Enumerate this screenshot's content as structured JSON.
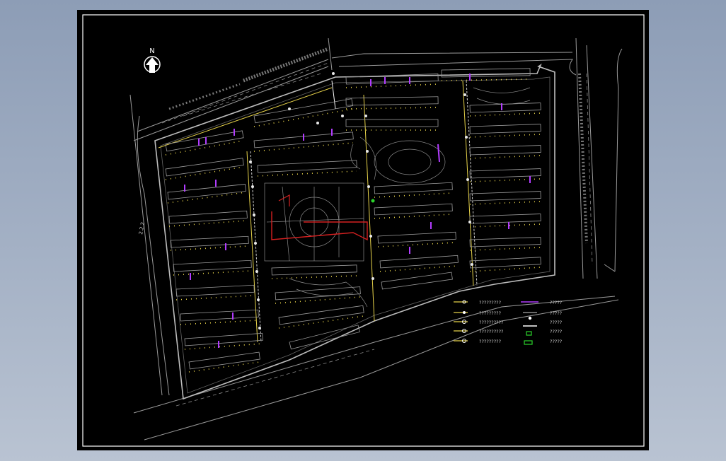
{
  "compass": {
    "north_label": "N"
  },
  "street_marker": "2.2.2",
  "legend": {
    "rows": [
      {
        "left_label": "?????????",
        "right_label": "?????"
      },
      {
        "left_label": "?????????",
        "right_label": "?????"
      },
      {
        "left_label": "??????????",
        "right_label": "?????"
      },
      {
        "left_label": "??????????",
        "right_label": "?????"
      },
      {
        "left_label": "?????????",
        "right_label": "?????"
      }
    ]
  },
  "colors": {
    "background": "#000000",
    "outline": "#ffffff",
    "site_boundary": "#bdbdbd",
    "building": "#9a9a9a",
    "pipe_yellow": "#e6d24a",
    "pipe_magenta": "#b23cff",
    "pipe_red": "#d42020",
    "pipe_green": "#2cd42c"
  }
}
